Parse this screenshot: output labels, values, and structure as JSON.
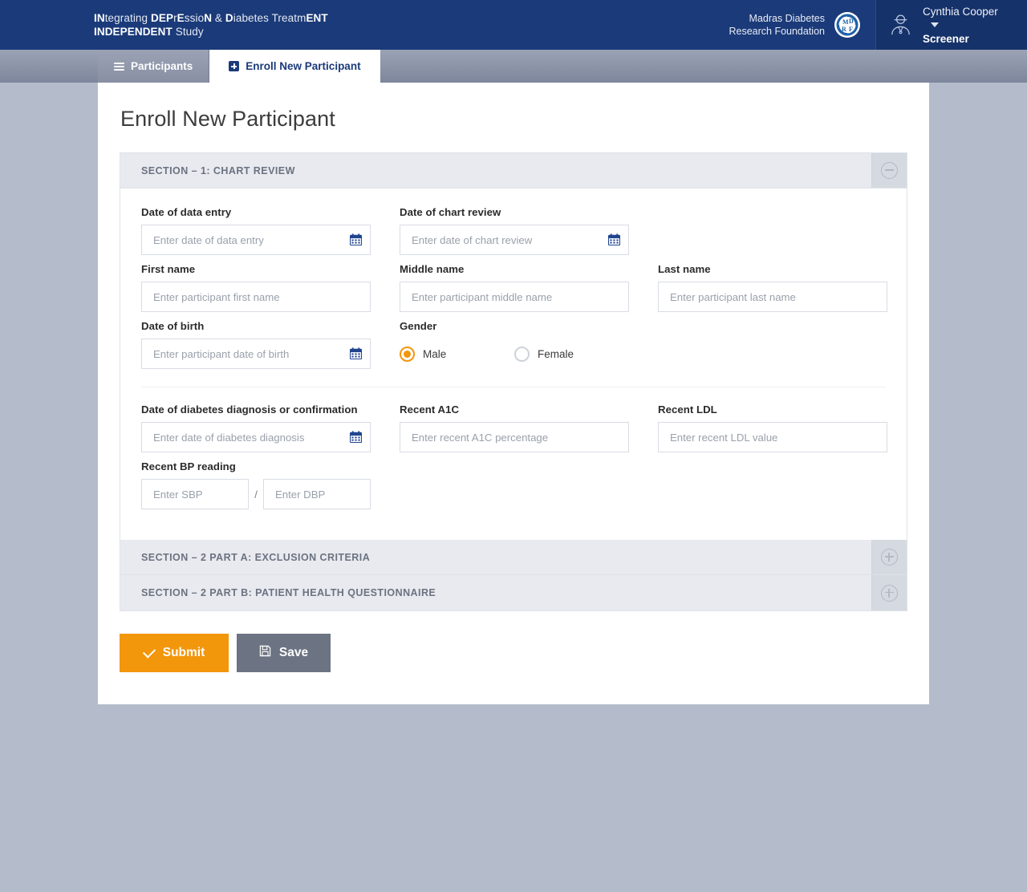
{
  "header": {
    "brand": {
      "line1_parts": [
        {
          "t": "IN",
          "b": true
        },
        {
          "t": "tegrating ",
          "b": false
        },
        {
          "t": "DEP",
          "b": true
        },
        {
          "t": "r",
          "b": false
        },
        {
          "t": "E",
          "b": true
        },
        {
          "t": "ssio",
          "b": false
        },
        {
          "t": "N",
          "b": true
        },
        {
          "t": " & ",
          "b": false
        },
        {
          "t": "D",
          "b": true
        },
        {
          "t": "iabetes Treatm",
          "b": false
        },
        {
          "t": "ENT",
          "b": true
        }
      ],
      "line2_bold": "INDEPENDENT",
      "line2_rest": " Study",
      "line1_plain": "INtegrating DEPrEssioN & Diabetes TreatmENT",
      "line2_plain": "INDEPENDENT Study"
    },
    "org": {
      "line1": "Madras Diabetes",
      "line2": "Research Foundation",
      "logo_icon": "mdrf-logo-icon",
      "logo_text": "MDRF"
    },
    "user": {
      "name": "Cynthia Cooper",
      "role": "Screener",
      "avatar_icon": "doctor-avatar-icon",
      "caret_icon": "chevron-down-icon"
    },
    "colors": {
      "topbar_bg": "#1b3a79",
      "userbox_bg": "#16326a"
    }
  },
  "tabs": [
    {
      "label": "Participants",
      "icon": "hamburger-icon",
      "active": false
    },
    {
      "label": "Enroll New Participant",
      "icon": "plus-square-icon",
      "active": true
    }
  ],
  "main": {
    "page_title": "Enroll New Participant",
    "sections": [
      {
        "id": "section-1",
        "title": "SECTION – 1: CHART REVIEW",
        "expanded": true,
        "toggle_icon": "minus-circle-icon"
      },
      {
        "id": "section-2a",
        "title": "SECTION – 2 PART A: EXCLUSION CRITERIA",
        "expanded": false,
        "toggle_icon": "plus-circle-icon"
      },
      {
        "id": "section-2b",
        "title": "SECTION – 2 PART B: PATIENT HEALTH QUESTIONNAIRE",
        "expanded": false,
        "toggle_icon": "plus-circle-icon"
      }
    ],
    "fields": {
      "date_of_data_entry": {
        "label": "Date of data entry",
        "placeholder": "Enter date of data entry",
        "value": "",
        "icon": "calendar-icon"
      },
      "date_of_chart_review": {
        "label": "Date of chart review",
        "placeholder": "Enter date of chart review",
        "value": "",
        "icon": "calendar-icon"
      },
      "first_name": {
        "label": "First name",
        "placeholder": "Enter participant first name",
        "value": ""
      },
      "middle_name": {
        "label": "Middle name",
        "placeholder": "Enter participant middle name",
        "value": ""
      },
      "last_name": {
        "label": "Last name",
        "placeholder": "Enter participant last name",
        "value": ""
      },
      "date_of_birth": {
        "label": "Date of birth",
        "placeholder": "Enter participant date of birth",
        "value": "",
        "icon": "calendar-icon"
      },
      "gender": {
        "label": "Gender",
        "options": [
          {
            "label": "Male",
            "selected": true
          },
          {
            "label": "Female",
            "selected": false
          }
        ],
        "selected_color": "#f2960b"
      },
      "date_of_diabetes_diagnosis": {
        "label": "Date of diabetes diagnosis or confirmation",
        "placeholder": "Enter date of diabetes diagnosis",
        "value": "",
        "icon": "calendar-icon"
      },
      "recent_a1c": {
        "label": "Recent A1C",
        "placeholder": "Enter recent A1C percentage",
        "value": ""
      },
      "recent_ldl": {
        "label": "Recent LDL",
        "placeholder": "Enter recent LDL value",
        "value": ""
      },
      "recent_bp": {
        "label": "Recent BP reading",
        "sbp_placeholder": "Enter SBP",
        "dbp_placeholder": "Enter DBP",
        "sbp_value": "",
        "dbp_value": "",
        "separator": "/"
      }
    },
    "buttons": {
      "submit": {
        "label": "Submit",
        "icon": "check-icon",
        "color": "#f2960b"
      },
      "save": {
        "label": "Save",
        "icon": "floppy-disk-icon",
        "color": "#6c7382"
      }
    }
  }
}
